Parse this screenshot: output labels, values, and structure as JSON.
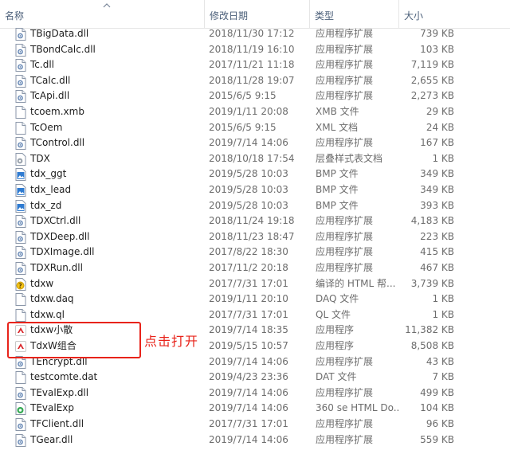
{
  "columns": {
    "name": "名称",
    "date": "修改日期",
    "type": "类型",
    "size": "大小"
  },
  "annotation": "点击打开",
  "colors": {
    "annotation": "#e8231a",
    "header_text": "#4c607a"
  },
  "files": [
    {
      "name": "TBigData.dll",
      "date": "2018/11/30 17:12",
      "type": "应用程序扩展",
      "size": "739 KB",
      "icon": "dll-gear-icon"
    },
    {
      "name": "TBondCalc.dll",
      "date": "2018/11/19 16:10",
      "type": "应用程序扩展",
      "size": "103 KB",
      "icon": "dll-gear-icon"
    },
    {
      "name": "Tc.dll",
      "date": "2017/11/21 11:18",
      "type": "应用程序扩展",
      "size": "7,119 KB",
      "icon": "dll-gear-icon"
    },
    {
      "name": "TCalc.dll",
      "date": "2018/11/28 19:07",
      "type": "应用程序扩展",
      "size": "2,655 KB",
      "icon": "dll-gear-icon"
    },
    {
      "name": "TcApi.dll",
      "date": "2015/6/5 9:15",
      "type": "应用程序扩展",
      "size": "2,273 KB",
      "icon": "dll-gear-icon"
    },
    {
      "name": "tcoem.xmb",
      "date": "2019/1/11 20:08",
      "type": "XMB 文件",
      "size": "29 KB",
      "icon": "blank-file-icon"
    },
    {
      "name": "TcOem",
      "date": "2015/6/5 9:15",
      "type": "XML 文档",
      "size": "24 KB",
      "icon": "blank-file-icon"
    },
    {
      "name": "TControl.dll",
      "date": "2019/7/14 14:06",
      "type": "应用程序扩展",
      "size": "167 KB",
      "icon": "dll-gear-icon"
    },
    {
      "name": "TDX",
      "date": "2018/10/18 17:54",
      "type": "层叠样式表文档",
      "size": "1 KB",
      "icon": "css-gear-icon"
    },
    {
      "name": "tdx_ggt",
      "date": "2019/5/28 10:03",
      "type": "BMP 文件",
      "size": "349 KB",
      "icon": "bmp-image-icon"
    },
    {
      "name": "tdx_lead",
      "date": "2019/5/28 10:03",
      "type": "BMP 文件",
      "size": "349 KB",
      "icon": "bmp-image-icon"
    },
    {
      "name": "tdx_zd",
      "date": "2019/5/28 10:03",
      "type": "BMP 文件",
      "size": "393 KB",
      "icon": "bmp-image-icon"
    },
    {
      "name": "TDXCtrl.dll",
      "date": "2018/11/24 19:18",
      "type": "应用程序扩展",
      "size": "4,183 KB",
      "icon": "dll-gear-icon"
    },
    {
      "name": "TDXDeep.dll",
      "date": "2018/11/23 18:47",
      "type": "应用程序扩展",
      "size": "223 KB",
      "icon": "dll-gear-icon"
    },
    {
      "name": "TDXImage.dll",
      "date": "2017/8/22 18:30",
      "type": "应用程序扩展",
      "size": "415 KB",
      "icon": "dll-gear-icon"
    },
    {
      "name": "TDXRun.dll",
      "date": "2017/11/2 20:18",
      "type": "应用程序扩展",
      "size": "467 KB",
      "icon": "dll-gear-icon"
    },
    {
      "name": "tdxw",
      "date": "2017/7/31 17:01",
      "type": "编译的 HTML 帮...",
      "size": "3,739 KB",
      "icon": "chm-help-icon"
    },
    {
      "name": "tdxw.daq",
      "date": "2019/1/11 20:10",
      "type": "DAQ 文件",
      "size": "1 KB",
      "icon": "blank-file-icon"
    },
    {
      "name": "tdxw.ql",
      "date": "2017/7/31 17:01",
      "type": "QL 文件",
      "size": "1 KB",
      "icon": "blank-file-icon"
    },
    {
      "name": "tdxw小散",
      "date": "2019/7/14 18:35",
      "type": "应用程序",
      "size": "11,382 KB",
      "icon": "tdx-app-icon"
    },
    {
      "name": "TdxW组合",
      "date": "2019/5/15 10:57",
      "type": "应用程序",
      "size": "8,508 KB",
      "icon": "tdx-app-icon"
    },
    {
      "name": "TEncrypt.dll",
      "date": "2019/7/14 14:06",
      "type": "应用程序扩展",
      "size": "43 KB",
      "icon": "dll-gear-icon"
    },
    {
      "name": "testcomte.dat",
      "date": "2019/4/23 23:36",
      "type": "DAT 文件",
      "size": "7 KB",
      "icon": "blank-file-icon"
    },
    {
      "name": "TEvalExp.dll",
      "date": "2019/7/14 14:06",
      "type": "应用程序扩展",
      "size": "499 KB",
      "icon": "dll-gear-icon"
    },
    {
      "name": "TEvalExp",
      "date": "2019/7/14 14:06",
      "type": "360 se HTML Do...",
      "size": "104 KB",
      "icon": "html-360-icon"
    },
    {
      "name": "TFClient.dll",
      "date": "2017/7/31 17:01",
      "type": "应用程序扩展",
      "size": "96 KB",
      "icon": "dll-gear-icon"
    },
    {
      "name": "TGear.dll",
      "date": "2019/7/14 14:06",
      "type": "应用程序扩展",
      "size": "559 KB",
      "icon": "dll-gear-icon"
    }
  ]
}
